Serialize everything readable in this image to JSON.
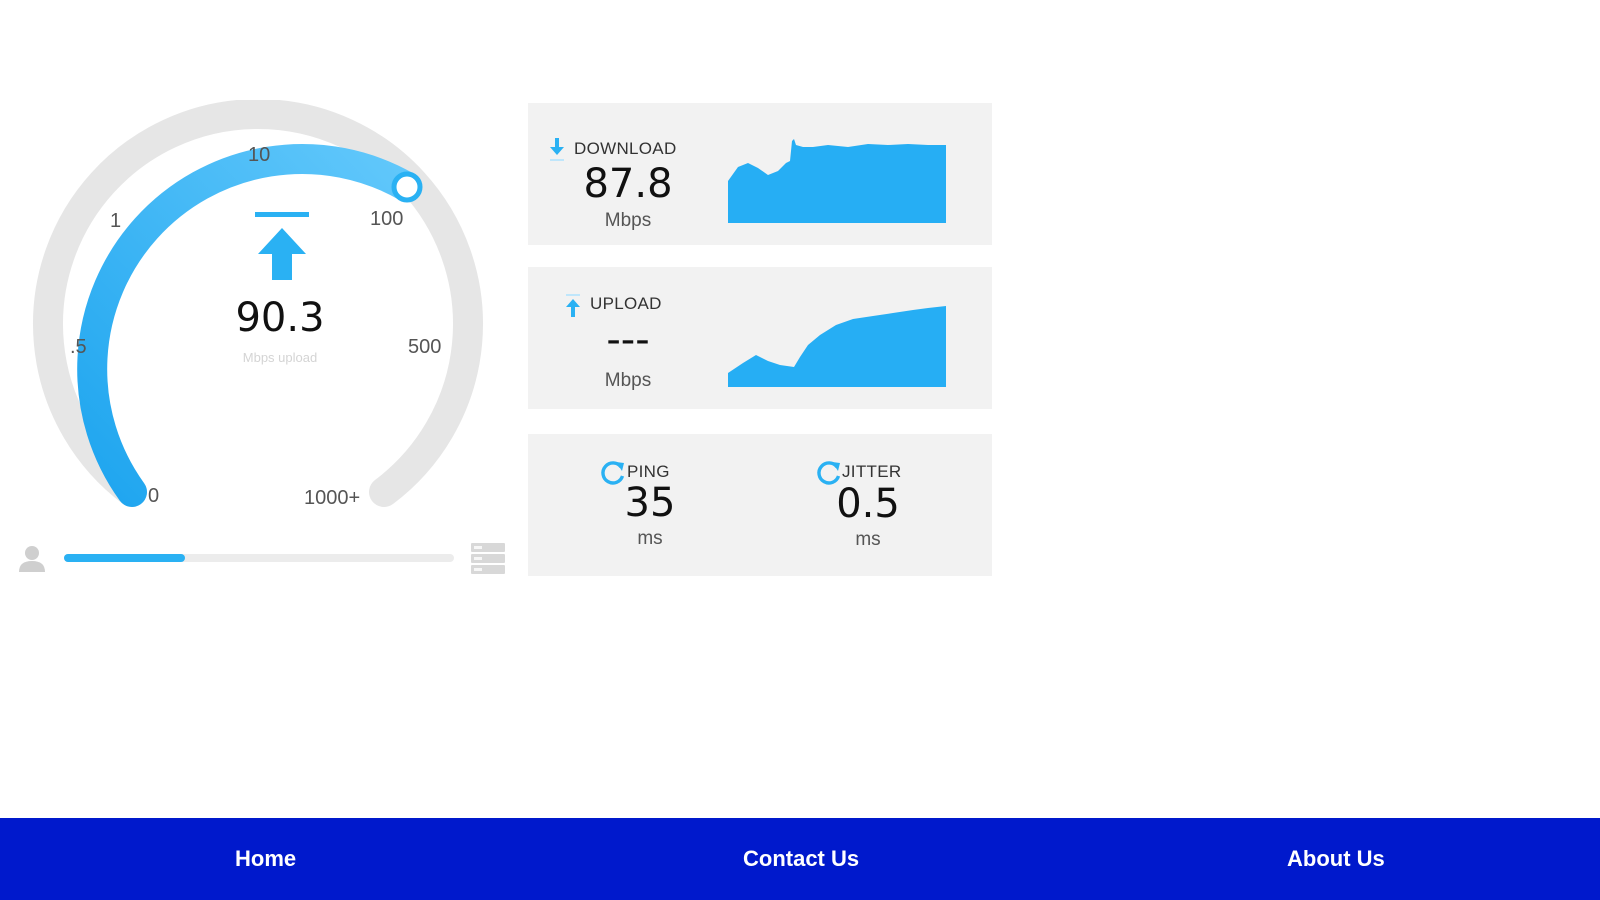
{
  "gauge": {
    "ticks": [
      "10",
      "1",
      "100",
      ".5",
      "500",
      "0",
      "1000+"
    ],
    "value": "90.3",
    "unit": "Mbps upload",
    "direction_icon": "arrow-up-icon"
  },
  "progress": {
    "fraction": 0.31,
    "user_icon": "user-icon",
    "server_icon": "server-icon"
  },
  "download": {
    "label": "DOWNLOAD",
    "value": "87.8",
    "unit": "Mbps",
    "icon": "arrow-down-icon"
  },
  "upload": {
    "label": "UPLOAD",
    "value": "---",
    "unit": "Mbps",
    "icon": "arrow-up-icon"
  },
  "ping": {
    "label": "PING",
    "value": "35",
    "unit": "ms",
    "icon": "refresh-icon"
  },
  "jitter": {
    "label": "JITTER",
    "value": "0.5",
    "unit": "ms",
    "icon": "refresh-icon"
  },
  "footer": {
    "home": "Home",
    "contact": "Contact Us",
    "about": "About Us"
  },
  "colors": {
    "accent": "#2ab1f3",
    "footer": "#0019cc",
    "card_bg": "#f2f2f2",
    "track": "#e6e6e6"
  }
}
